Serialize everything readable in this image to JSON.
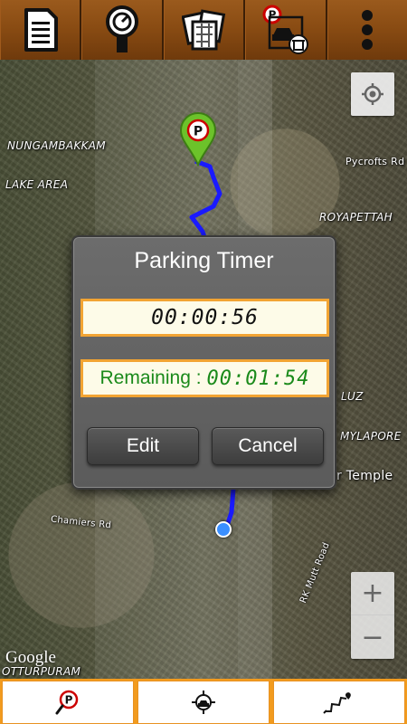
{
  "toolbar": {
    "buttons": [
      {
        "icon": "document-icon"
      },
      {
        "icon": "parking-meter-icon"
      },
      {
        "icon": "map-pages-icon"
      },
      {
        "icon": "clear-parking-icon"
      },
      {
        "icon": "more-vert-icon"
      }
    ]
  },
  "map": {
    "labels": {
      "nungambakkam": "NUNGAMBAKKAM",
      "lake_area": "LAKE AREA",
      "pycrofts": "Pycrofts Rd",
      "royapettah": "ROYAPETTAH",
      "luz": "LUZ",
      "mylapore": "MYLAPORE",
      "temple": "r Temple",
      "chamiers": "Chamiers Rd",
      "rk_mutt": "RK Mutt Road",
      "otturpuram": "OTTURPURAM",
      "google": "Google"
    },
    "zoom_in": "+",
    "zoom_out": "−",
    "route_color": "#1a1aff"
  },
  "dialog": {
    "title": "Parking Timer",
    "elapsed": "00:00:56",
    "remaining_label": "Remaining :",
    "remaining_value": "00:01:54",
    "edit_label": "Edit",
    "cancel_label": "Cancel",
    "accent_color": "#f2a433",
    "remaining_color": "#1a8a1a"
  },
  "bottombar": {
    "buttons": [
      {
        "icon": "find-parking-icon"
      },
      {
        "icon": "my-location-target-icon"
      },
      {
        "icon": "route-directions-icon"
      }
    ]
  }
}
